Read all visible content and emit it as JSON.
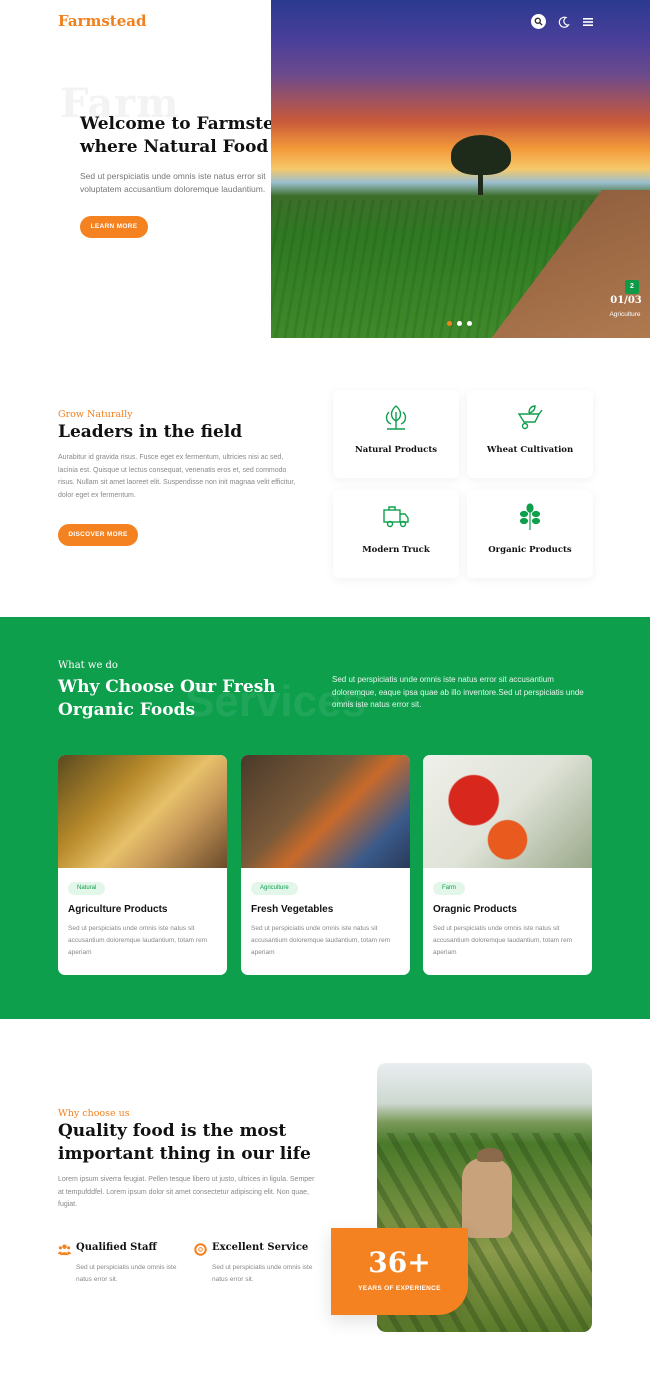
{
  "header": {
    "logo": "Farmstead"
  },
  "hero": {
    "bg_word": "Farm",
    "title": "Welcome to Farmstead where Natural Food is born!",
    "description": "Sed ut perspiciatis unde omnis iste natus error sit voluptatem accusantium doloremque laudantium.",
    "button": "LEARN MORE",
    "slide_badge": "2",
    "slide_counter": "01/03",
    "slide_caption": "Agriculture"
  },
  "leaders": {
    "subtitle": "Grow Naturally",
    "title": "Leaders in the field",
    "description": "Aurabitur id gravida risus. Fusce eget ex fermentum, ultricies nisi ac sed, lacinia est. Quisque ut lectus consequat, venenatis eros et, sed commodo risus. Nullam sit amet laoreet elit. Suspendisse non init magnaa velit efficitur, dolor eget ex fermentum.",
    "button": "DISCOVER MORE",
    "features": [
      {
        "label": "Natural Products",
        "icon": "plant-icon"
      },
      {
        "label": "Wheat Cultivation",
        "icon": "wheelbarrow-icon"
      },
      {
        "label": "Modern Truck",
        "icon": "truck-icon"
      },
      {
        "label": "Organic Products",
        "icon": "tree-icon"
      }
    ]
  },
  "services": {
    "bg_word": "Services",
    "subtitle": "What we do",
    "title": "Why Choose Our Fresh Organic Foods",
    "description": "Sed ut perspiciatis unde omnis iste natus error sit accusantium doloremque, eaque ipsa quae ab illo inventore.Sed ut perspiciatis unde omnis iste natus error sit.",
    "cards": [
      {
        "tag": "Natural",
        "title": "Agriculture Products",
        "desc": "Sed ut perspiciatis unde omnis iste natus sit accusantium doloremque laudantium, totam rem aperiam"
      },
      {
        "tag": "Agriculture",
        "title": "Fresh Vegetables",
        "desc": "Sed ut perspiciatis unde omnis iste natus sit accusantium doloremque laudantium, totam rem aperiam"
      },
      {
        "tag": "Farm",
        "title": "Oragnic Products",
        "desc": "Sed ut perspiciatis unde omnis iste natus sit accusantium doloremque laudantium, totam rem aperiam"
      }
    ]
  },
  "why": {
    "subtitle": "Why choose us",
    "title": "Quality food is the most important thing in our life",
    "description": "Lorem ipsum siverra feugiat. Pellen tesque libero ut justo, ultrices in ligula. Semper at tempufddfel. Lorem ipsum dolor sit amet consectetur adipiscing elit. Non quae, fugiat.",
    "features": [
      {
        "title": "Qualified Staff",
        "desc": "Sed ut perspiciatis unde omnis iste natus error sit."
      },
      {
        "title": "Excellent Service",
        "desc": "Sed ut perspiciatis unde omnis iste natus error sit."
      }
    ],
    "experience_number": "36+",
    "experience_label": "YEARS OF EXPERIENCE"
  },
  "colors": {
    "accent": "#f58220",
    "green": "#0e9f4c"
  }
}
